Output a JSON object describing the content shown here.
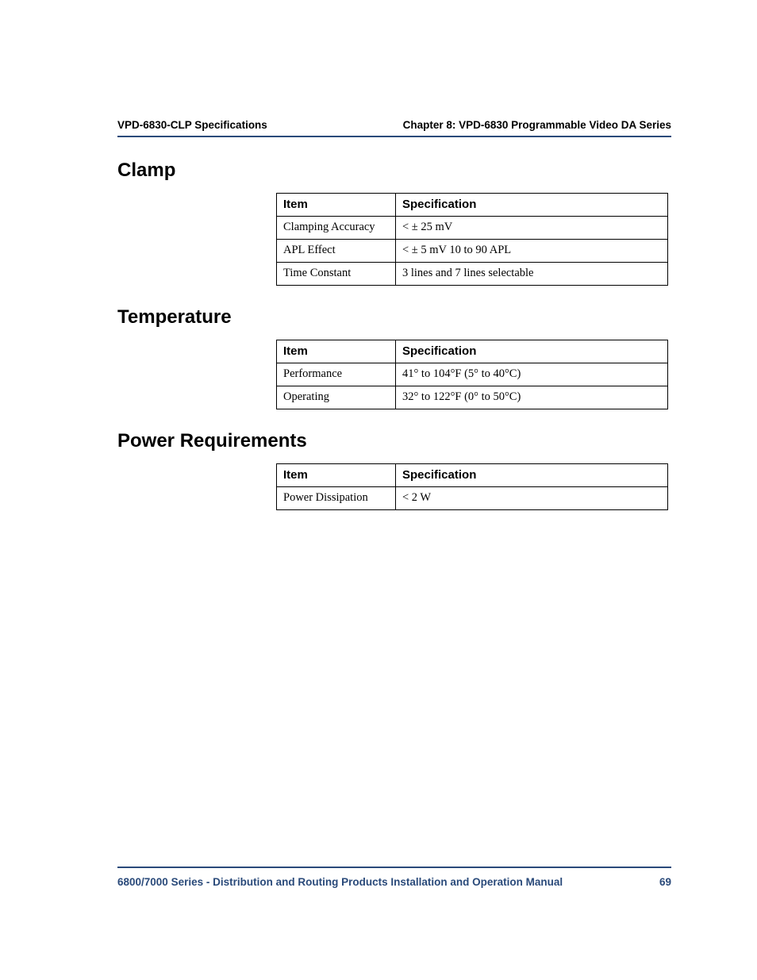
{
  "header": {
    "left": "VPD-6830-CLP Specifications",
    "right": "Chapter 8: VPD-6830 Programmable Video DA Series"
  },
  "sections": [
    {
      "title": "Clamp",
      "headers": {
        "item": "Item",
        "spec": "Specification"
      },
      "rows": [
        {
          "item": "Clamping Accuracy",
          "spec": "< ± 25 mV"
        },
        {
          "item": "APL Effect",
          "spec": "< ± 5 mV 10 to 90 APL"
        },
        {
          "item": "Time Constant",
          "spec": "3 lines and 7 lines selectable"
        }
      ]
    },
    {
      "title": "Temperature",
      "headers": {
        "item": "Item",
        "spec": "Specification"
      },
      "rows": [
        {
          "item": "Performance",
          "spec": "41° to 104°F (5° to 40°C)"
        },
        {
          "item": "Operating",
          "spec": "32° to 122°F (0° to 50°C)"
        }
      ]
    },
    {
      "title": "Power Requirements",
      "headers": {
        "item": "Item",
        "spec": "Specification"
      },
      "rows": [
        {
          "item": "Power Dissipation",
          "spec": "< 2 W"
        }
      ]
    }
  ],
  "footer": {
    "left": "6800/7000 Series - Distribution and Routing Products Installation and Operation Manual",
    "page": "69"
  }
}
